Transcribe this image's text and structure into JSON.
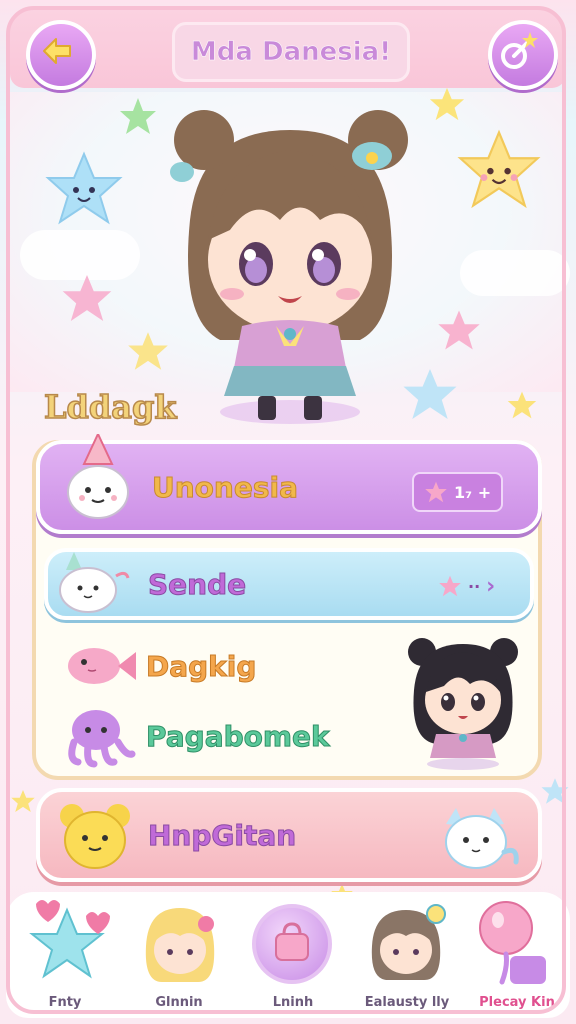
{
  "header": {
    "title": "Mda Danesia!",
    "back_icon": "back-arrow-icon",
    "settings_icon": "sparkle-wand-icon"
  },
  "section": {
    "label": "Lddagk"
  },
  "menu": {
    "items": [
      {
        "label": "Unonesia",
        "badge_text": "1₇ +",
        "icon": "party-bunny-icon",
        "color": "#f1b84a"
      },
      {
        "label": "Sende",
        "badge_text": "··",
        "icon": "party-kitty-icon",
        "color": "#c06ad8"
      },
      {
        "label": "Dagkig",
        "icon": "pink-fish-icon",
        "color": "#f4a64c"
      },
      {
        "label": "Pagabomek",
        "icon": "purple-octopus-icon",
        "color": "#5bc99a"
      },
      {
        "label": "HnpGitan",
        "icon": "yellow-bear-icon",
        "color": "#c06ad8"
      }
    ]
  },
  "bottom_nav": {
    "items": [
      {
        "label": "Fnty",
        "icon": "heart-star-icon",
        "color": "#6b5a7b"
      },
      {
        "label": "Glnnin",
        "icon": "blonde-girl-icon",
        "color": "#6b5a7b"
      },
      {
        "label": "Lninh",
        "icon": "shopping-bag-icon",
        "color": "#6b5a7b"
      },
      {
        "label": "Ealausty lly",
        "icon": "brown-hair-boy-icon",
        "color": "#6b5a7b"
      },
      {
        "label": "Plecay Kin",
        "icon": "pink-balloon-icon",
        "color": "#e0508f"
      }
    ]
  },
  "colors": {
    "accent_purple": "#c47be0",
    "accent_pink": "#f7bfd3",
    "row1_bg": "#d9a6ef",
    "row2_bg": "#b9e6f5",
    "row5_bg": "#f9c7cc"
  }
}
